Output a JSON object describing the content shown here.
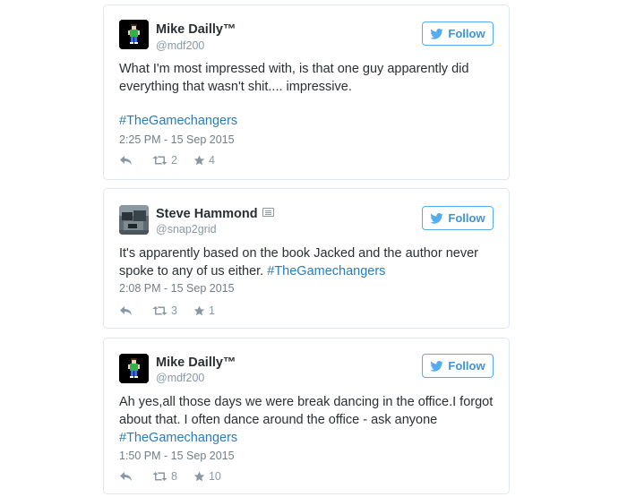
{
  "colors": {
    "link": "#2b7bb9",
    "follow_border": "#55acee",
    "muted": "#8899a6",
    "card_border": "#e1e8ed"
  },
  "tweets": [
    {
      "name": "Mike Dailly™",
      "handle": "@mdf200",
      "avatar_icon": "pixel-character-icon",
      "follow_label": "Follow",
      "text": "What I'm most impressed with, is that one guy apparently did everything that wasn't shit.... impressive.",
      "hashtag": "#TheGamechangers",
      "timestamp": "2:25 PM - 15 Sep 2015",
      "retweets": "2",
      "favorites": "4"
    },
    {
      "name": "Steve Hammond",
      "handle": "@snap2grid",
      "avatar_icon": "photo-avatar",
      "follow_label": "Follow",
      "text": "It's apparently based on the book Jacked and the author never spoke to any of us either.",
      "hashtag": "#TheGamechangers",
      "timestamp": "2:08 PM - 15 Sep 2015",
      "retweets": "3",
      "favorites": "1"
    },
    {
      "name": "Mike Dailly™",
      "handle": "@mdf200",
      "avatar_icon": "pixel-character-icon",
      "follow_label": "Follow",
      "text": "Ah yes,all those days we were break dancing in the office.I forgot about that. I often dance around the office - ask anyone",
      "hashtag": "#TheGamechangers",
      "timestamp": "1:50 PM - 15 Sep 2015",
      "retweets": "8",
      "favorites": "10"
    }
  ]
}
